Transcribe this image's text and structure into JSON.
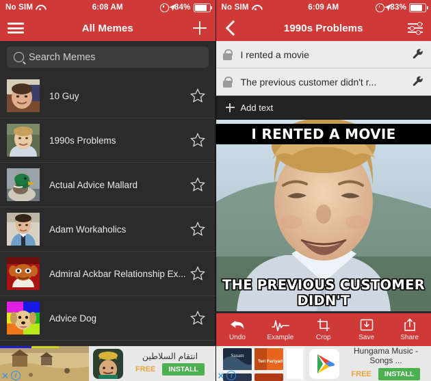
{
  "theme": {
    "accent": "#cf3a39",
    "dark_bg": "#2b2b2b",
    "row_bg": "#ececec",
    "install_green": "#4caf50"
  },
  "left": {
    "status": {
      "carrier": "No SIM",
      "time": "6:08 AM",
      "battery": "84%",
      "wifi_icon": "wifi-icon",
      "alarm_icon": "alarm-icon",
      "location_icon": "location-arrow-icon",
      "battery_icon": "battery-icon"
    },
    "nav": {
      "menu_icon": "hamburger-menu-icon",
      "title": "All Memes",
      "add_icon": "plus-icon"
    },
    "search": {
      "icon": "search-icon",
      "placeholder": "Search Memes",
      "value": ""
    },
    "list": [
      {
        "label": "10 Guy",
        "star": "star-outline-icon"
      },
      {
        "label": "1990s Problems",
        "star": "star-outline-icon"
      },
      {
        "label": "Actual Advice Mallard",
        "star": "star-outline-icon"
      },
      {
        "label": "Adam Workaholics",
        "star": "star-outline-icon"
      },
      {
        "label": "Admiral Ackbar Relationship Ex...",
        "star": "star-outline-icon"
      },
      {
        "label": "Advice Dog",
        "star": "star-outline-icon"
      }
    ],
    "ad": {
      "title": "انتقام السلاطين",
      "free": "FREE",
      "install": "INSTALL",
      "close_icon": "close-ad-icon",
      "info_icon": "ad-info-icon",
      "store_icon": "app-icon"
    }
  },
  "right": {
    "status": {
      "carrier": "No SIM",
      "time": "6:09 AM",
      "battery": "83%",
      "wifi_icon": "wifi-icon",
      "alarm_icon": "alarm-icon",
      "location_icon": "location-arrow-icon",
      "battery_icon": "battery-icon"
    },
    "nav": {
      "back_icon": "back-chevron-icon",
      "title": "1990s Problems",
      "settings_icon": "sliders-icon"
    },
    "text_rows": [
      {
        "lock_icon": "lock-icon",
        "text": "I rented a movie",
        "edit_icon": "wrench-icon"
      },
      {
        "lock_icon": "lock-icon",
        "text": "The previous customer didn't r...",
        "edit_icon": "wrench-icon"
      }
    ],
    "add_text": {
      "icon": "plus-icon",
      "label": "Add text"
    },
    "meme": {
      "top_caption": "I RENTED A MOVIE",
      "bottom_caption": "THE PREVIOUS CUSTOMER DIDN'T"
    },
    "toolbar": [
      {
        "label": "Undo",
        "icon": "undo-arrow-icon"
      },
      {
        "label": "Example",
        "icon": "waveform-icon"
      },
      {
        "label": "Crop",
        "icon": "crop-icon"
      },
      {
        "label": "Save",
        "icon": "save-download-icon"
      },
      {
        "label": "Share",
        "icon": "share-upload-icon"
      }
    ],
    "ad": {
      "title": "Hungama Music - Songs ...",
      "free": "FREE",
      "install": "INSTALL",
      "close_icon": "close-ad-icon",
      "info_icon": "ad-info-icon",
      "store_icon": "google-play-icon"
    }
  }
}
